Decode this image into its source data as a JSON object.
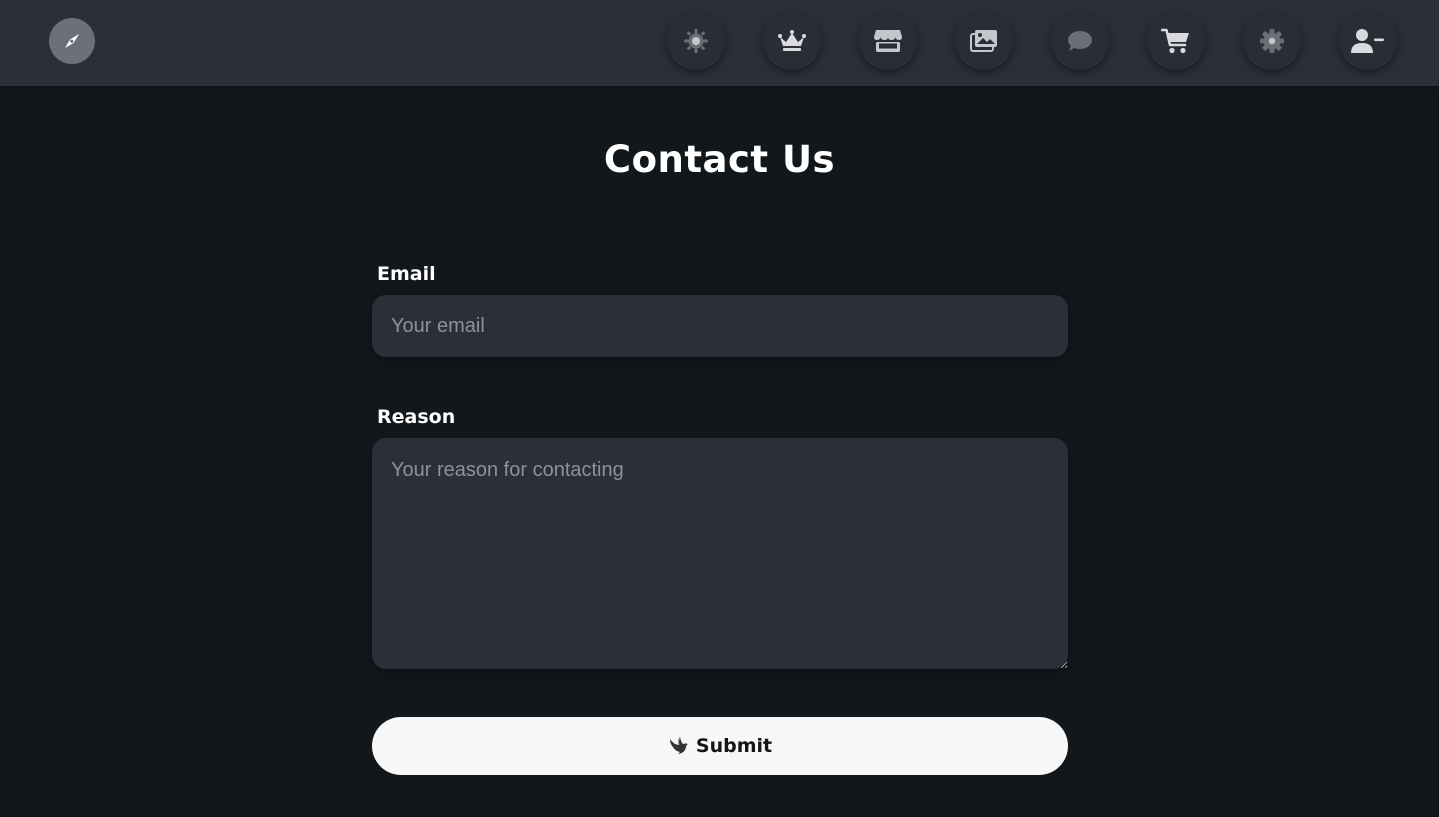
{
  "header": {
    "logo_icon": "compass-icon",
    "nav": [
      {
        "name": "brightness-icon",
        "label": ""
      },
      {
        "name": "crown-icon",
        "label": ""
      },
      {
        "name": "store-icon",
        "label": ""
      },
      {
        "name": "gallery-icon",
        "label": ""
      },
      {
        "name": "chat-icon",
        "label": ""
      },
      {
        "name": "cart-icon",
        "label": ""
      },
      {
        "name": "gear-icon",
        "label": ""
      },
      {
        "name": "user-minus-icon",
        "label": ""
      }
    ]
  },
  "page": {
    "title": "Contact Us"
  },
  "form": {
    "email_label": "Email",
    "email_placeholder": "Your email",
    "email_value": "",
    "reason_label": "Reason",
    "reason_placeholder": "Your reason for contacting",
    "reason_value": "",
    "submit_label": "Submit",
    "submit_icon": "bird-icon"
  },
  "colors": {
    "background": "#12171b",
    "header": "#2c2f37",
    "input": "#2c2f37",
    "button": "#f7f7f7",
    "icon": "#c4c7cc"
  }
}
